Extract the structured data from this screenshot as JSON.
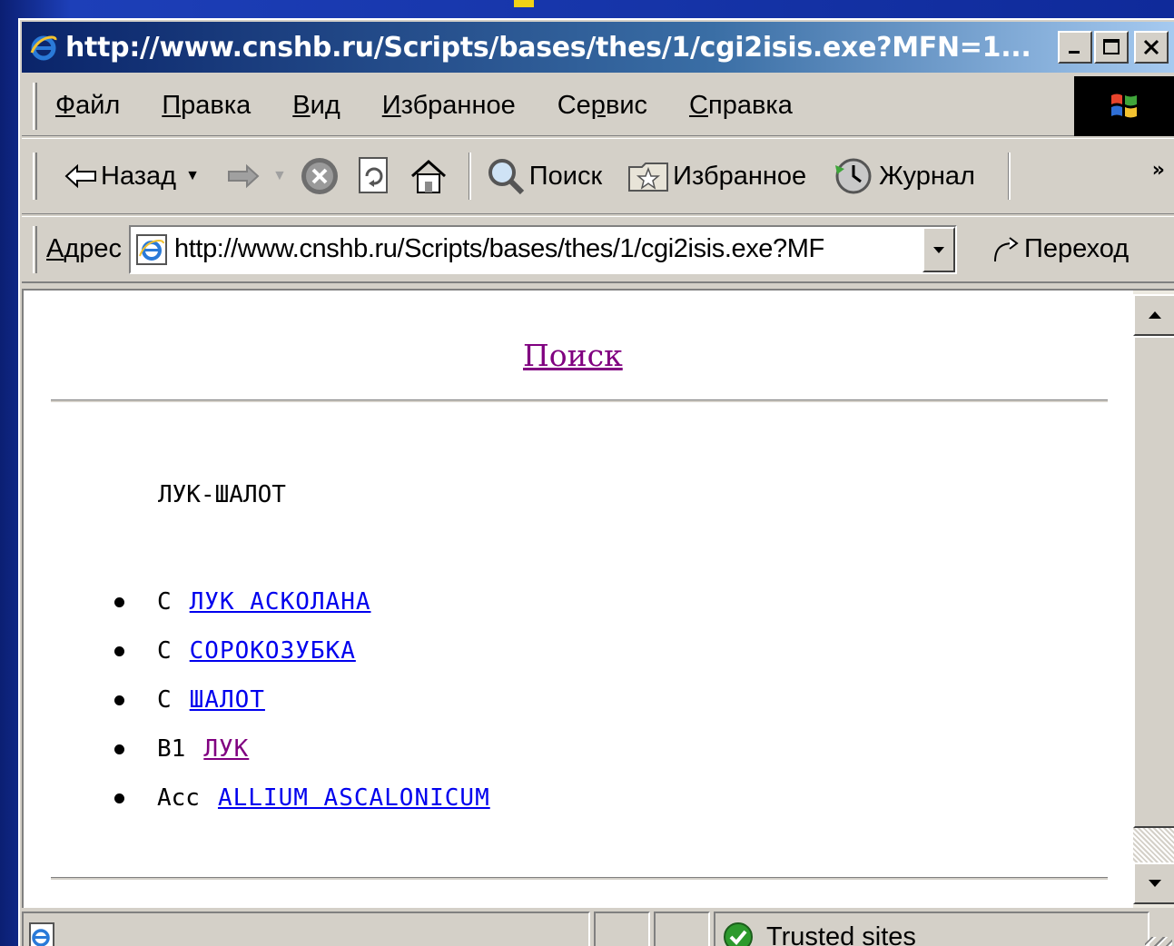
{
  "window": {
    "title": "http://www.cnshb.ru/Scripts/bases/thes/1/cgi2isis.exe?MFN=1...",
    "title_icon": "ie-icon",
    "buttons": {
      "minimize": "_",
      "maximize": "□",
      "close": "X"
    }
  },
  "menubar": {
    "items": [
      {
        "accel": "Ф",
        "rest": "айл"
      },
      {
        "accel": "П",
        "rest": "равка"
      },
      {
        "accel": "В",
        "rest": "ид"
      },
      {
        "accel": "И",
        "rest": "збранное"
      },
      {
        "pre": "Се",
        "accel": "р",
        "rest": "вис"
      },
      {
        "accel": "С",
        "rest": "правка"
      }
    ],
    "logo_icon": "windows-flag-icon"
  },
  "toolbar": {
    "back_label": "Назад",
    "back_icon": "back-arrow-icon",
    "forward_icon": "forward-arrow-icon",
    "stop_icon": "stop-icon",
    "refresh_icon": "refresh-icon",
    "home_icon": "home-icon",
    "search_label": "Поиск",
    "search_icon": "search-icon",
    "favorites_label": "Избранное",
    "favorites_icon": "favorites-icon",
    "history_label": "Журнал",
    "history_icon": "history-icon",
    "more_label": "»"
  },
  "addressbar": {
    "label_accel": "А",
    "label_rest": "дрес",
    "url": "http://www.cnshb.ru/Scripts/bases/thes/1/cgi2isis.exe?MF",
    "go_label": "Переход",
    "go_icon": "go-arrow-icon"
  },
  "page": {
    "search_link": "Поиск",
    "term": "ЛУК-ШАЛОТ",
    "relations": [
      {
        "code": "С",
        "link": "ЛУК АСКОЛАНА",
        "visited": false
      },
      {
        "code": "С",
        "link": "СОРОКОЗУБКА",
        "visited": false
      },
      {
        "code": "С",
        "link": "ШАЛОТ",
        "visited": false
      },
      {
        "code": "В1",
        "link": "ЛУК",
        "visited": true
      },
      {
        "code": "Acc",
        "link": "ALLIUM ASCALONICUM",
        "visited": false
      }
    ]
  },
  "statusbar": {
    "page_icon": "page-icon",
    "zone_icon": "trusted-check-icon",
    "zone_label": "Trusted sites"
  },
  "colors": {
    "link": "#0000ee",
    "visited_link": "#800080",
    "titlebar_start": "#0a246a",
    "titlebar_end": "#a6caf0",
    "chrome": "#d4d0c8"
  }
}
